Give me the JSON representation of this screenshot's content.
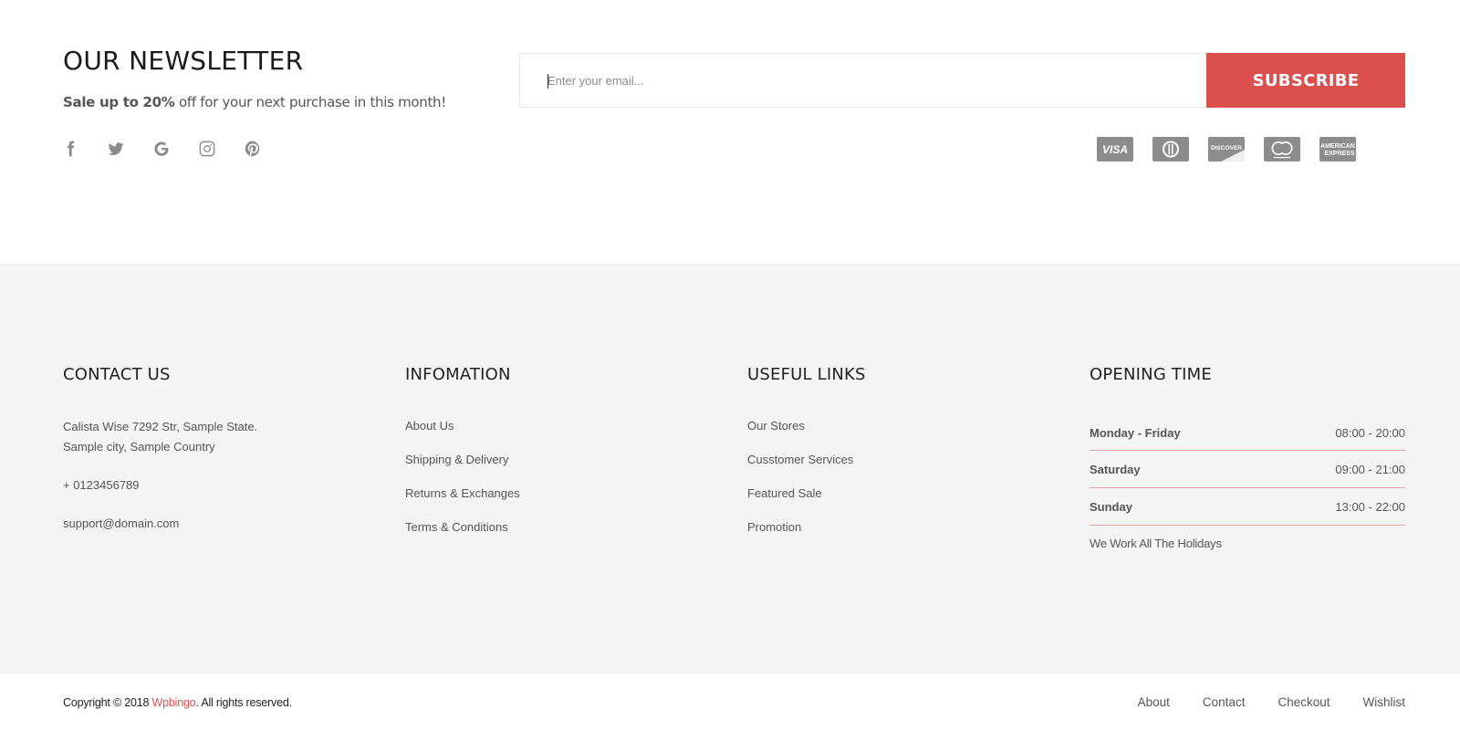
{
  "newsletter": {
    "title": "OUR NEWSLETTER",
    "sub_bold": "Sale up to 20%",
    "sub_rest": " off for your next purchase in this month!",
    "email_placeholder": "Enter your email...",
    "subscribe_label": "SUBSCRIBE",
    "social_icons": [
      "facebook-icon",
      "twitter-icon",
      "google-icon",
      "instagram-icon",
      "pinterest-icon"
    ],
    "payment_icons": [
      "visa-icon",
      "diners-club-icon",
      "discover-icon",
      "mastercard-icon",
      "american-express-icon"
    ]
  },
  "contact": {
    "heading": "CONTACT US",
    "address_line1": "Calista Wise 7292 Str, Sample State.",
    "address_line2": "Sample city, Sample Country",
    "phone": "+ 0123456789",
    "email": "support@domain.com"
  },
  "information": {
    "heading": "INFOMATION",
    "items": [
      "About Us",
      "Shipping & Delivery",
      "Returns & Exchanges",
      "Terms & Conditions"
    ]
  },
  "useful_links": {
    "heading": "USEFUL LINKS",
    "items": [
      "Our Stores",
      "Cusstomer Services",
      "Featured Sale",
      "Promotion"
    ]
  },
  "opening": {
    "heading": "OPENING TIME",
    "rows": [
      {
        "day": "Monday - Friday",
        "hours": "08:00 - 20:00"
      },
      {
        "day": "Saturday",
        "hours": "09:00 - 21:00"
      },
      {
        "day": "Sunday",
        "hours": "13:00 - 22:00"
      }
    ],
    "note": "We Work All The Holidays"
  },
  "bottom": {
    "copyright_prefix": "Copyright © 2018 ",
    "brand": "Wpbingo",
    "copyright_suffix": ". All rights reserved.",
    "nav": [
      "About",
      "Contact",
      "Checkout",
      "Wishlist"
    ]
  },
  "colors": {
    "accent": "#dc4f4f",
    "footer_bg": "#f4f4f4",
    "icon_gray": "#8a8a8a"
  }
}
